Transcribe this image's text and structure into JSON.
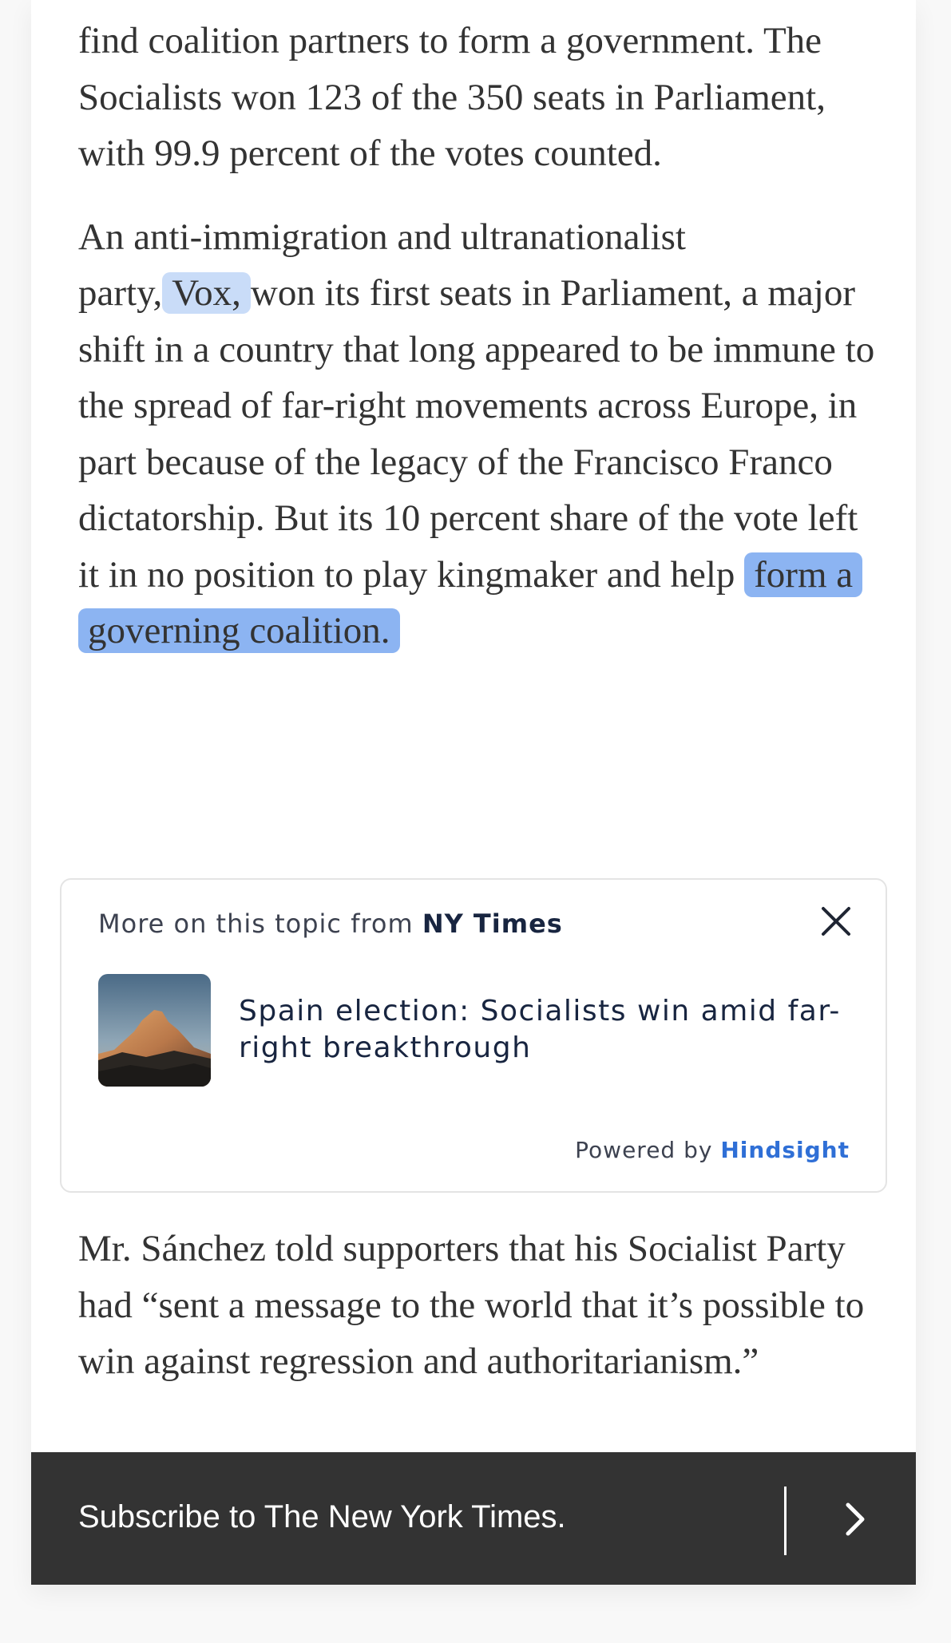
{
  "article": {
    "para1": "find coalition partners to form a government. The Socialists won 123 of the 350 seats in Parliament, with 99.9 percent of the votes counted.",
    "para2": {
      "before": "An anti-immigration and ultranationalist party,",
      "vox": "Vox,",
      "middle": "won its first seats in Parliament, a major shift in a country that long appeared to be immune to the spread of far-right movements across Europe, in part because of the legacy of the Francisco Franco dictatorship. But its 10 percent share of the vote left it in no position to play kingmaker and help",
      "highlight": "form a governing coalition."
    },
    "para3": "Mr. Sánchez told supporters that his Socialist Party had “sent a message to the world that it’s possible to win against regression and authoritarianism.”"
  },
  "topic_card": {
    "header_prefix": "More on this topic from",
    "header_source": "NY Times",
    "close_icon": "close-icon",
    "thumbnail_icon": "mountain-thumbnail",
    "title": "Spain election: Socialists win amid far-right breakthrough",
    "powered_prefix": "Powered by",
    "powered_brand": "Hindsight"
  },
  "subscribe_bar": {
    "text": "Subscribe to The New York Times.",
    "arrow_icon": "chevron-right-icon"
  },
  "colors": {
    "highlight_light": "#c9dcf8",
    "highlight_strong": "#8cb4f2",
    "brand_link": "#2f6fd6",
    "subscribe_bg": "#333333"
  }
}
